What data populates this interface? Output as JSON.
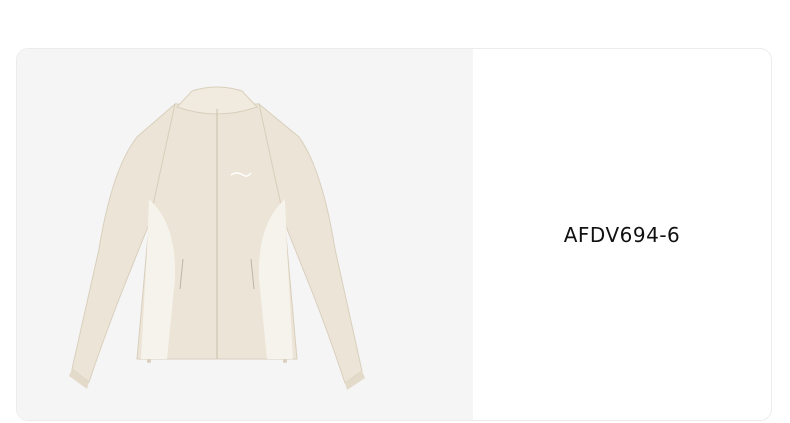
{
  "product": {
    "sku": "AFDV694-6",
    "image_icon": "jacket-product-image",
    "colors": {
      "jacket_body": "#ece4d6",
      "jacket_panel": "#f6f3ec",
      "background": "#f5f5f5"
    }
  }
}
